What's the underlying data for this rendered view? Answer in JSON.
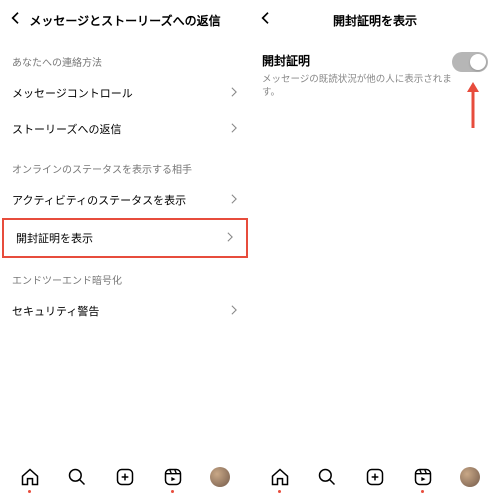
{
  "left": {
    "title": "メッセージとストーリーズへの返信",
    "sections": {
      "contact_method": "あなたへの連絡方法",
      "online_status": "オンラインのステータスを表示する相手",
      "e2e": "エンドツーエンド暗号化"
    },
    "rows": {
      "message_control": "メッセージコントロール",
      "stories_reply": "ストーリーズへの返信",
      "activity_status": "アクティビティのステータスを表示",
      "read_receipt": "開封証明を表示",
      "security_alert": "セキュリティ警告"
    }
  },
  "right": {
    "title": "開封証明を表示",
    "toggle_label": "開封証明",
    "toggle_sub": "メッセージの既読状況が他の人に表示されます。"
  }
}
